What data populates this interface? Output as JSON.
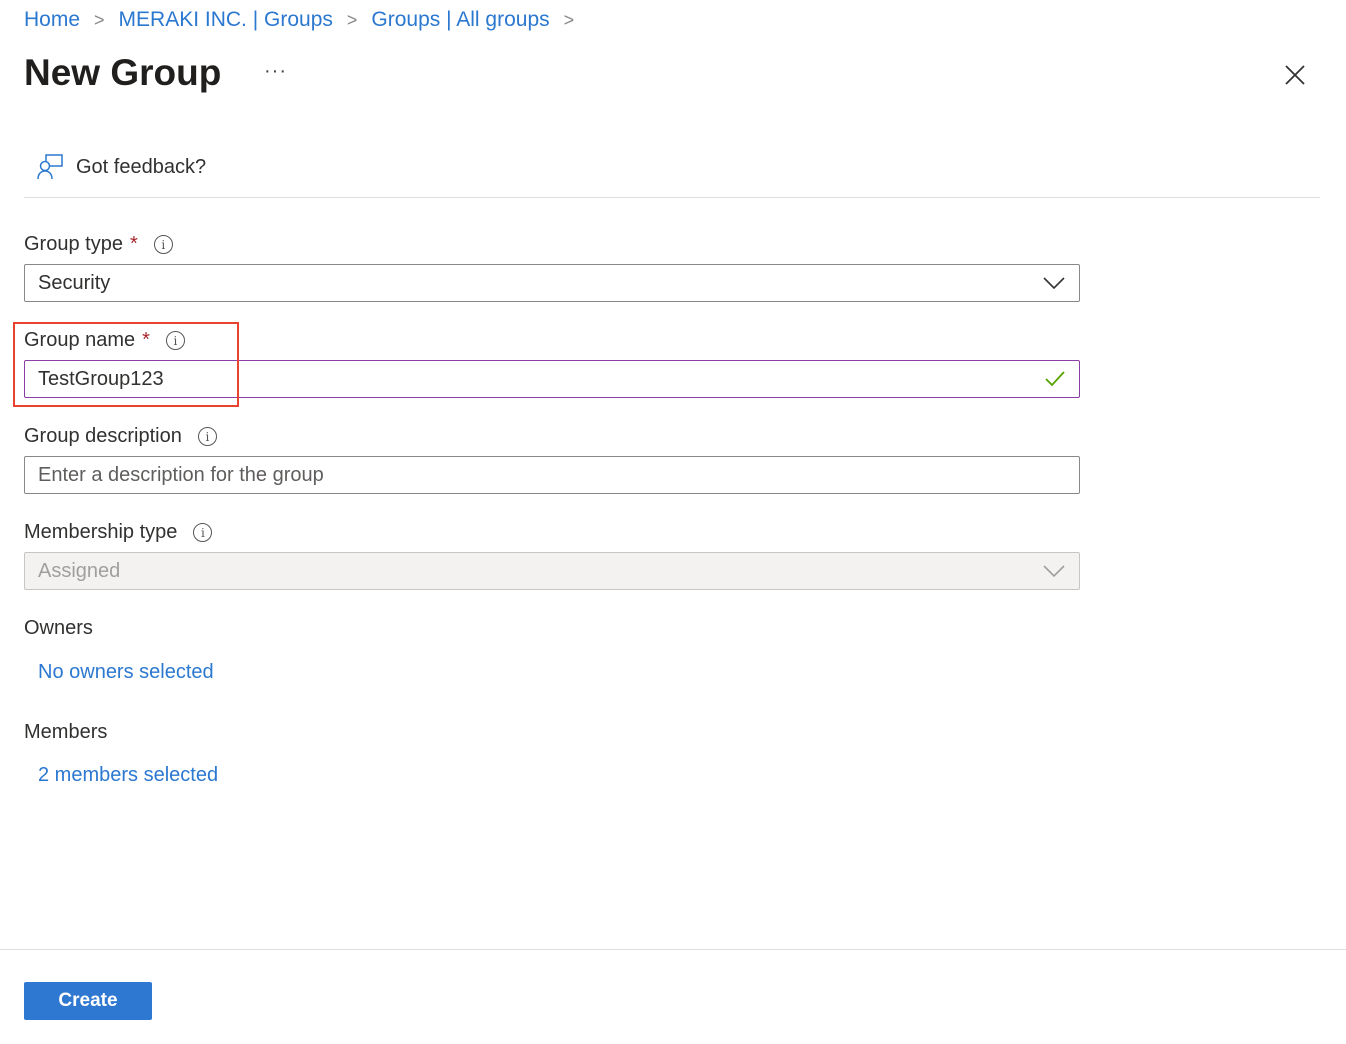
{
  "breadcrumb": [
    "Home",
    "MERAKI INC. | Groups",
    "Groups | All groups"
  ],
  "title": "New Group",
  "more": "···",
  "feedback": "Got feedback?",
  "fields": {
    "group_type": {
      "label": "Group type",
      "required": "*",
      "value": "Security"
    },
    "group_name": {
      "label": "Group name",
      "required": "*",
      "value": "TestGroup123"
    },
    "group_description": {
      "label": "Group description",
      "placeholder": "Enter a description for the group"
    },
    "membership_type": {
      "label": "Membership type",
      "value": "Assigned"
    },
    "owners": {
      "label": "Owners",
      "link": "No owners selected"
    },
    "members": {
      "label": "Members",
      "link": "2 members selected"
    }
  },
  "create_label": "Create",
  "colors": {
    "accent": "#2f78d1",
    "link": "#2b78d0",
    "highlight": "#e8432e",
    "valid": "#57a300"
  }
}
